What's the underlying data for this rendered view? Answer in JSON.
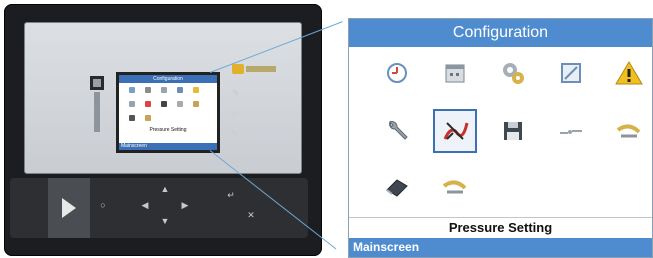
{
  "menu": {
    "title": "Configuration",
    "selected_caption": "Pressure Setting",
    "footer": "Mainscreen",
    "icons": [
      {
        "name": "clock-icon",
        "row": 0,
        "col": 0
      },
      {
        "name": "calendar-icon",
        "row": 0,
        "col": 1
      },
      {
        "name": "gears-icon",
        "row": 0,
        "col": 2
      },
      {
        "name": "display-settings-icon",
        "row": 0,
        "col": 3
      },
      {
        "name": "warning-icon",
        "row": 0,
        "col": 4
      },
      {
        "name": "wrench-icon",
        "row": 1,
        "col": 0
      },
      {
        "name": "pressure-setting-icon",
        "row": 1,
        "col": 1,
        "selected": true
      },
      {
        "name": "save-icon",
        "row": 1,
        "col": 2
      },
      {
        "name": "network-icon",
        "row": 1,
        "col": 3
      },
      {
        "name": "sensor-icon",
        "row": 1,
        "col": 4
      },
      {
        "name": "eraser-icon",
        "row": 2,
        "col": 0
      },
      {
        "name": "sensor-icon",
        "row": 2,
        "col": 1
      }
    ]
  },
  "device": {
    "mini_title": "Configuration",
    "mini_caption": "Pressure Setting",
    "mini_footer": "Mainscreen"
  },
  "colors": {
    "accent": "#4f8ccf",
    "selection": "#3b6fb6",
    "warning": "#f0c020",
    "device_body": "#1c1d20"
  }
}
